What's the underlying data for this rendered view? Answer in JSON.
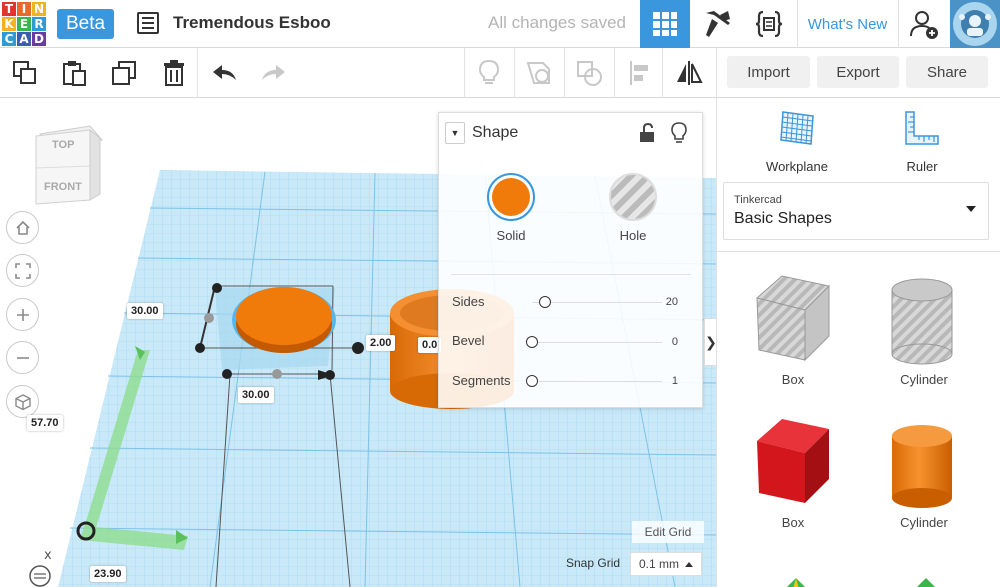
{
  "topbar": {
    "logo_letters": [
      "T",
      "I",
      "N",
      "K",
      "E",
      "R",
      "C",
      "A",
      "D"
    ],
    "beta_label": "Beta",
    "design_title": "Tremendous Esboo",
    "save_status": "All changes saved",
    "whats_new": "What's New"
  },
  "toolbar": {
    "import_label": "Import",
    "export_label": "Export",
    "share_label": "Share"
  },
  "viewcube": {
    "top": "TOP",
    "front": "FRONT"
  },
  "dimensions": {
    "depth": "30.00",
    "width": "30.00",
    "gap": "2.00",
    "offset_partial": "0.0",
    "height": "57.70",
    "origin_x": "23.90"
  },
  "inspector": {
    "title": "Shape",
    "solid_label": "Solid",
    "hole_label": "Hole",
    "solid_color": "#f07b0b",
    "props": [
      {
        "label": "Sides",
        "value": "20",
        "fraction": 0.1
      },
      {
        "label": "Bevel",
        "value": "0",
        "fraction": 0.0
      },
      {
        "label": "Segments",
        "value": "1",
        "fraction": 0.0
      }
    ]
  },
  "right_panel": {
    "workplane_label": "Workplane",
    "ruler_label": "Ruler",
    "library_brand": "Tinkercad",
    "library_name": "Basic Shapes",
    "shapes": [
      {
        "label": "Box"
      },
      {
        "label": "Cylinder"
      },
      {
        "label": "Box"
      },
      {
        "label": "Cylinder"
      }
    ]
  },
  "grid": {
    "edit_label": "Edit Grid",
    "snap_label": "Snap Grid",
    "snap_value": "0.1 mm"
  },
  "colors": {
    "accent": "#3a96dd",
    "grid": "#c6e6f6",
    "orange": "#f07b0b",
    "red": "#d3161b"
  }
}
